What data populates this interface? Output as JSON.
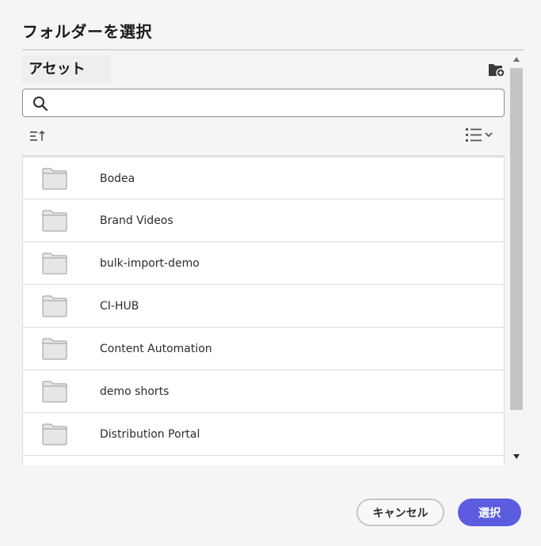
{
  "dialog": {
    "title": "フォルダーを選択"
  },
  "panel": {
    "header_label": "アセット",
    "new_folder_icon": "new-folder-icon"
  },
  "search": {
    "placeholder": "",
    "value": "",
    "icon": "search-icon"
  },
  "toolbar": {
    "sort_icon": "sort-icon",
    "view_icon": "list-view-icon"
  },
  "folders": [
    {
      "label": "Bodea"
    },
    {
      "label": "Brand Videos"
    },
    {
      "label": "bulk-import-demo"
    },
    {
      "label": "CI-HUB"
    },
    {
      "label": "Content Automation"
    },
    {
      "label": "demo shorts"
    },
    {
      "label": "Distribution Portal"
    },
    {
      "label": ""
    }
  ],
  "buttons": {
    "cancel_label": "キャンセル",
    "select_label": "選択"
  },
  "colors": {
    "accent": "#5c5ce0",
    "folder_fill": "#e6e6e6",
    "folder_stroke": "#9a9a9a"
  }
}
